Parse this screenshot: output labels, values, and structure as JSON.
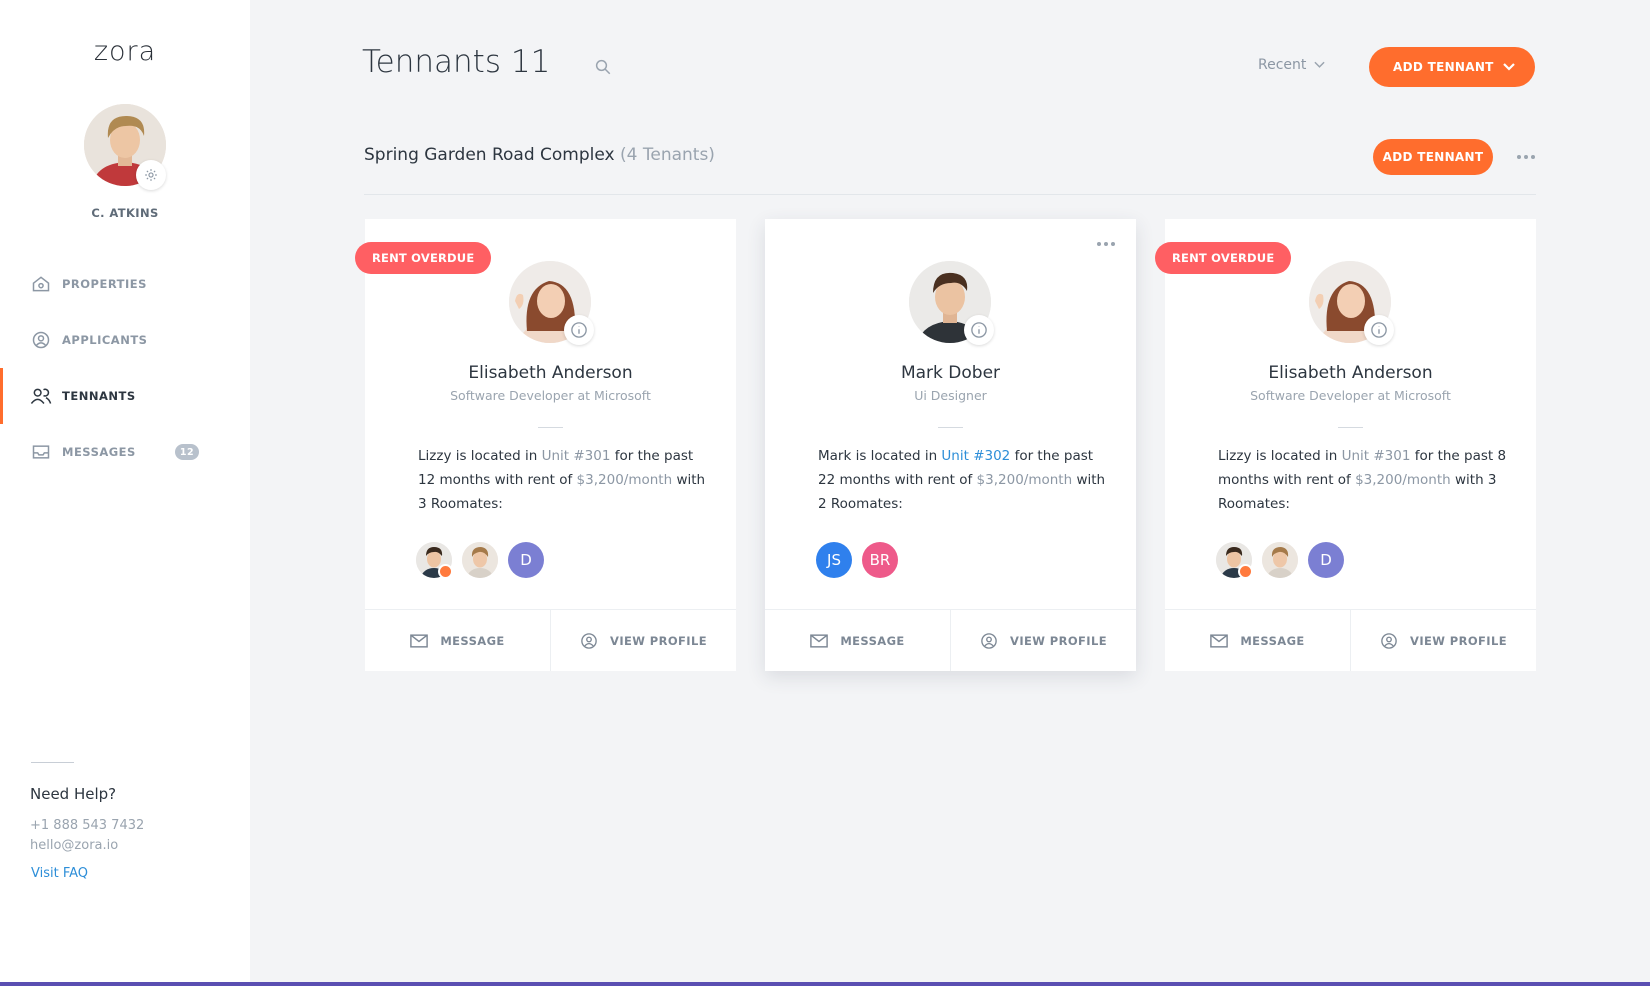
{
  "app": {
    "logo": "zora",
    "accent": "#ff6d2d",
    "link_color": "#2d8ed8"
  },
  "user": {
    "name": "C. ATKINS"
  },
  "nav": [
    {
      "label": "PROPERTIES",
      "icon": "home-icon"
    },
    {
      "label": "APPLICANTS",
      "icon": "user-circle-icon"
    },
    {
      "label": "TENNANTS",
      "icon": "users-icon",
      "active": true
    },
    {
      "label": "MESSAGES",
      "icon": "inbox-icon",
      "badge": "12"
    }
  ],
  "help": {
    "title": "Need Help?",
    "phone": "+1 888 543 7432",
    "email": "hello@zora.io",
    "faq": "Visit FAQ"
  },
  "header": {
    "title": "Tennants 11",
    "sort": "Recent",
    "add_button": "ADD TENNANT"
  },
  "group": {
    "name": "Spring Garden Road Complex",
    "count": "(4 Tenants)",
    "add_button": "ADD TENNANT"
  },
  "cards": [
    {
      "ribbon": "RENT OVERDUE",
      "name": "Elisabeth Anderson",
      "role": "Software Developer at Microsoft",
      "desc": {
        "p1": "Lizzy is located in ",
        "unit": "Unit #301",
        "p2": " for the past 12 months with rent of ",
        "rent": "$3,200/month",
        "p3": " with 3 Roomates:"
      },
      "mates": [
        {
          "type": "photo",
          "face": "man",
          "checked": true
        },
        {
          "type": "photo",
          "face": "man2"
        },
        {
          "type": "initial",
          "text": "D",
          "color": "#7b7fd3"
        }
      ],
      "message": "MESSAGE",
      "view": "VIEW PROFILE"
    },
    {
      "name": "Mark Dober",
      "role": "Ui Designer",
      "desc": {
        "p1": "Mark is located in ",
        "unit": "Unit #302",
        "p2": " for the past 22 months with rent of ",
        "rent": "$3,200/month",
        "p3": " with 2 Roomates:"
      },
      "mates": [
        {
          "type": "initial",
          "text": "JS",
          "color": "#2f80ed"
        },
        {
          "type": "initial",
          "text": "BR",
          "color": "#ee5a8a"
        }
      ],
      "message": "MESSAGE",
      "view": "VIEW PROFILE"
    },
    {
      "ribbon": "RENT OVERDUE",
      "name": "Elisabeth Anderson",
      "role": "Software Developer at Microsoft",
      "desc": {
        "p1": "Lizzy is located in ",
        "unit": "Unit #301",
        "p2": " for the past 8 months with rent of ",
        "rent": "$3,200/month",
        "p3": " with 3 Roomates:"
      },
      "mates": [
        {
          "type": "photo",
          "face": "man",
          "checked": true
        },
        {
          "type": "photo",
          "face": "man2"
        },
        {
          "type": "initial",
          "text": "D",
          "color": "#7b7fd3"
        }
      ],
      "message": "MESSAGE",
      "view": "VIEW PROFILE"
    }
  ]
}
